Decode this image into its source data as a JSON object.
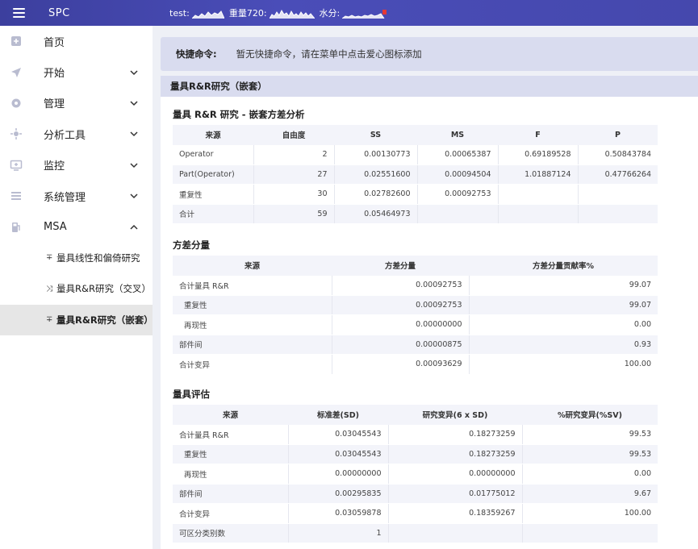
{
  "topbar": {
    "app_title": "SPC",
    "metrics": [
      {
        "label": "test:"
      },
      {
        "label": "重量720:"
      },
      {
        "label": "水分:"
      }
    ]
  },
  "sidebar": {
    "items": [
      {
        "label": "首页",
        "icon": "home-icon"
      },
      {
        "label": "开始",
        "icon": "send-icon"
      },
      {
        "label": "管理",
        "icon": "gear-icon"
      },
      {
        "label": "分析工具",
        "icon": "analysis-icon"
      },
      {
        "label": "监控",
        "icon": "monitor-icon"
      },
      {
        "label": "系统管理",
        "icon": "list-icon"
      },
      {
        "label": "MSA",
        "icon": "fuel-icon"
      }
    ],
    "msa_subitems": [
      {
        "label": "量具线性和偏倚研究"
      },
      {
        "label": "量具R&R研究（交叉）"
      },
      {
        "label": "量具R&R研究（嵌套）"
      }
    ]
  },
  "quick_command": {
    "label": "快捷命令:",
    "text": "暂无快捷命令，请在菜单中点击爱心图标添加"
  },
  "panel": {
    "title": "量具R&R研究（嵌套）",
    "anova": {
      "title": "量具 R&R 研究 - 嵌套方差分析",
      "headers": [
        "来源",
        "自由度",
        "SS",
        "MS",
        "F",
        "P"
      ],
      "rows": [
        [
          "Operator",
          "2",
          "0.00130773",
          "0.00065387",
          "0.69189528",
          "0.50843784"
        ],
        [
          "Part(Operator)",
          "27",
          "0.02551600",
          "0.00094504",
          "1.01887124",
          "0.47766264"
        ],
        [
          "重复性",
          "30",
          "0.02782600",
          "0.00092753",
          "",
          ""
        ],
        [
          "合计",
          "59",
          "0.05464973",
          "",
          "",
          ""
        ]
      ]
    },
    "variance": {
      "title": "方差分量",
      "headers": [
        "来源",
        "方差分量",
        "方差分量贡献率%"
      ],
      "rows": [
        [
          "合计量具 R&R",
          "0.00092753",
          "99.07"
        ],
        [
          "重复性",
          "0.00092753",
          "99.07"
        ],
        [
          "再现性",
          "0.00000000",
          "0.00"
        ],
        [
          "部件间",
          "0.00000875",
          "0.93"
        ],
        [
          "合计变异",
          "0.00093629",
          "100.00"
        ]
      ]
    },
    "gauge": {
      "title": "量具评估",
      "headers": [
        "来源",
        "标准差(SD)",
        "研究变异(6 x SD)",
        "%研究变异(%SV)"
      ],
      "rows": [
        [
          "合计量具 R&R",
          "0.03045543",
          "0.18273259",
          "99.53"
        ],
        [
          "重复性",
          "0.03045543",
          "0.18273259",
          "99.53"
        ],
        [
          "再现性",
          "0.00000000",
          "0.00000000",
          "0.00"
        ],
        [
          "部件间",
          "0.00295835",
          "0.01775012",
          "9.67"
        ],
        [
          "合计变异",
          "0.03059878",
          "0.18359267",
          "100.00"
        ],
        [
          "可区分类别数",
          "1",
          "",
          ""
        ]
      ]
    }
  },
  "colors": {
    "topbar": "#4548ad",
    "accent_light": "#d9dcef",
    "sparkline_alert": "#e53935"
  }
}
